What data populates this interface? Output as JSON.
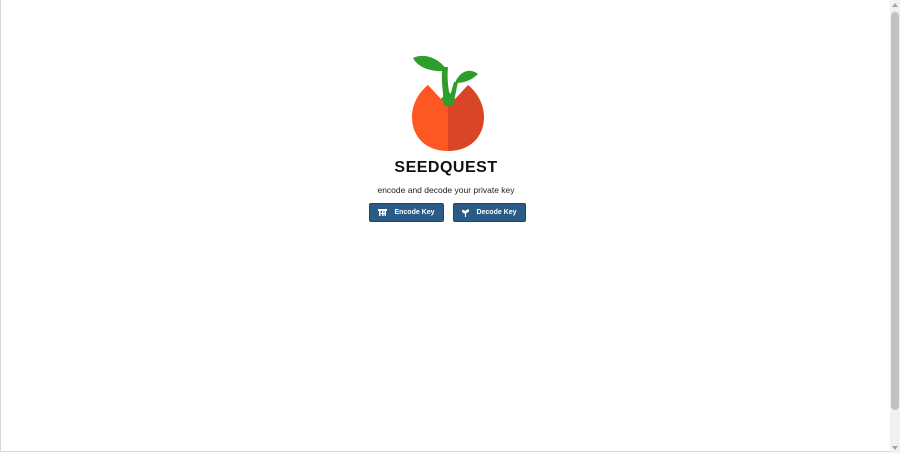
{
  "app": {
    "title": "SEEDQUEST",
    "tagline": "encode and decode your private key"
  },
  "actions": {
    "encode": {
      "label": "Encode Key",
      "icon": "encode-icon"
    },
    "decode": {
      "label": "Decode Key",
      "icon": "decode-icon"
    }
  },
  "colors": {
    "button_bg": "#2b5c87",
    "seed_left": "#ff5722",
    "seed_right": "#d84527",
    "sprout": "#2e9e2a"
  }
}
